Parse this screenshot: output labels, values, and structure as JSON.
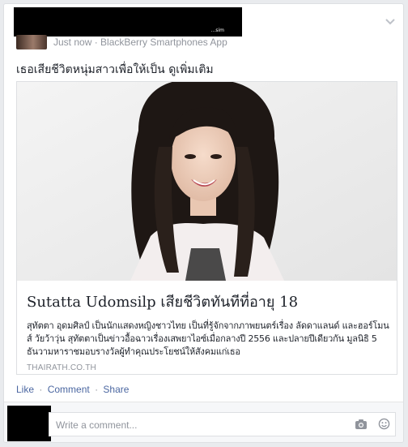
{
  "post": {
    "redacted_name_tail": "…sim",
    "meta": "Just now · BlackBerry Smartphones App",
    "status_text": "เธอเสียชีวิตหนุ่มสาวเพื่อให้เป็น ดูเพิ่มเติม"
  },
  "link": {
    "title": "Sutatta Udomsilp เสียชีวิตทันทีที่อายุ 18",
    "description": "สุทัตตา อุดมศิลป์ เป็นนักแสดงหญิงชาวไทย เป็นที่รู้จักจากภาพยนตร์เรื่อง ลัดดาแลนด์ และฮอร์โมนส์ วัยว้าวุ่น สุทัตตาเป็นข่าวอื้อฉาวเรื่องเสพยาไอซ์เมื่อกลางปี 2556 และปลายปีเดียวกัน มูลนิธิ 5 ธันวามหาราชมอบรางวัลผู้ทำคุณประโยชน์ให้สังคมแก่เธอ",
    "domain": "THAIRATH.CO.TH"
  },
  "actions": {
    "like": "Like",
    "comment": "Comment",
    "share": "Share",
    "separator": "·"
  },
  "comment": {
    "placeholder": "Write a comment..."
  },
  "icons": {
    "menu": "chevron-down-icon",
    "camera": "camera-icon",
    "emoji": "emoji-icon"
  },
  "colors": {
    "link_blue": "#4b67a1",
    "meta_gray": "#90949c",
    "background": "#e9ebee"
  }
}
